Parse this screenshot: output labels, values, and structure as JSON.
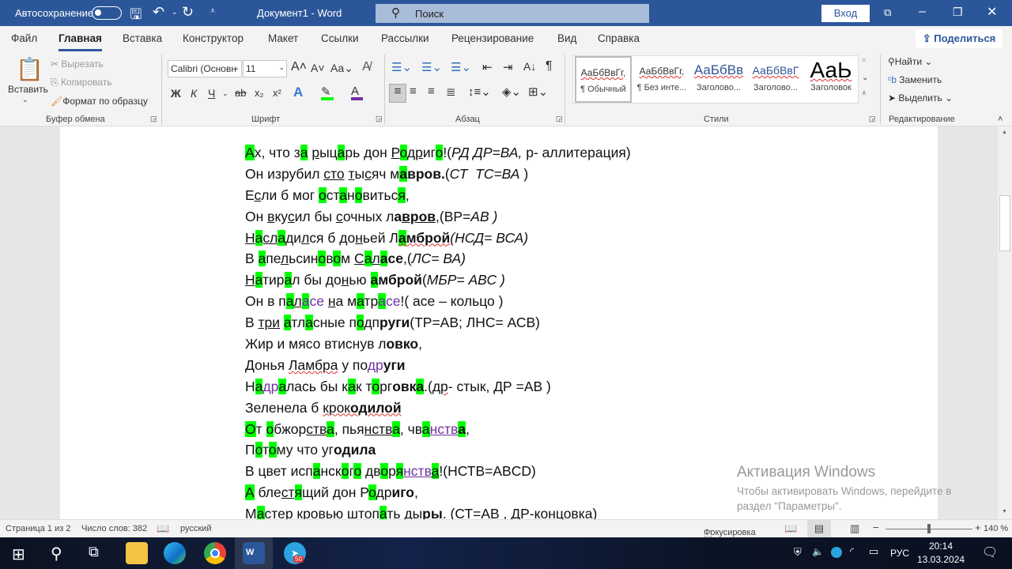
{
  "titlebar": {
    "autosave": "Автосохранение",
    "title": "Документ1  -  Word",
    "search": "Поиск",
    "login": "Вход"
  },
  "tabs": [
    "Файл",
    "Главная",
    "Вставка",
    "Конструктор",
    "Макет",
    "Ссылки",
    "Рассылки",
    "Рецензирование",
    "Вид",
    "Справка"
  ],
  "share": "Поделиться",
  "ribbon": {
    "clipboard": {
      "paste": "Вставить",
      "cut": "Вырезать",
      "copy": "Копировать",
      "format_painter": "Формат по образцу",
      "label": "Буфер обмена"
    },
    "font": {
      "name": "Calibri (Основн",
      "size": "11",
      "case": "Aa",
      "bold": "Ж",
      "italic": "К",
      "underline": "Ч",
      "strike": "ab",
      "sub": "x₂",
      "sup": "x²",
      "label": "Шрифт",
      "highlight_color": "#00ff00",
      "font_color": "#7030a0"
    },
    "paragraph": {
      "label": "Абзац"
    },
    "styles": {
      "items": [
        {
          "sample": "АаБбВвГг,",
          "name": "¶ Обычный"
        },
        {
          "sample": "АаБбВвГг,",
          "name": "¶ Без инте..."
        },
        {
          "sample": "АаБбВв",
          "name": "Заголово..."
        },
        {
          "sample": "АаБбВвГ",
          "name": "Заголово..."
        },
        {
          "sample": "АаЬ",
          "name": "Заголовок"
        }
      ],
      "label": "Стили"
    },
    "editing": {
      "find": "Найти",
      "replace": "Заменить",
      "select": "Выделить",
      "label": "Редактирование"
    }
  },
  "document": {
    "lines": [
      [
        {
          "t": "А",
          "f": "h"
        },
        {
          "t": "х, что з"
        },
        {
          "t": "а",
          "f": "h"
        },
        {
          "t": " "
        },
        {
          "t": "р",
          "f": "u"
        },
        {
          "t": "ыц"
        },
        {
          "t": "а",
          "f": "h"
        },
        {
          "t": "рь "
        },
        {
          "t": "д",
          "f": "u"
        },
        {
          "t": "он "
        },
        {
          "t": "Р",
          "f": "u"
        },
        {
          "t": "о",
          "f": "h"
        },
        {
          "t": "др",
          "f": "u"
        },
        {
          "t": "иг"
        },
        {
          "t": "о",
          "f": "h"
        },
        {
          "t": "!("
        },
        {
          "t": "РД ДР=ВА,",
          "f": "i"
        },
        {
          "t": " р- аллитерация)"
        }
      ],
      [
        {
          "t": "Он изрубил "
        },
        {
          "t": "сто",
          "f": "u"
        },
        {
          "t": " "
        },
        {
          "t": "т",
          "f": "u"
        },
        {
          "t": "ы"
        },
        {
          "t": "с",
          "f": "u"
        },
        {
          "t": "яч м"
        },
        {
          "t": "а",
          "f": "hb"
        },
        {
          "t": "вров.",
          "f": "b"
        },
        {
          "t": "("
        },
        {
          "t": "СТ  ТС=ВА",
          "f": "i"
        },
        {
          "t": " )"
        }
      ],
      [
        {
          "t": "Е"
        },
        {
          "t": "с",
          "f": "u"
        },
        {
          "t": "ли б мог "
        },
        {
          "t": "о",
          "f": "h"
        },
        {
          "t": "ст"
        },
        {
          "t": "а",
          "f": "h"
        },
        {
          "t": "н"
        },
        {
          "t": "о",
          "f": "h"
        },
        {
          "t": "вить"
        },
        {
          "t": "с"
        },
        {
          "t": "я",
          "f": "h"
        },
        {
          "t": ","
        }
      ],
      [
        {
          "t": "Он "
        },
        {
          "t": "в",
          "f": "u"
        },
        {
          "t": "ку"
        },
        {
          "t": "с",
          "f": "u"
        },
        {
          "t": "ил бы "
        },
        {
          "t": "с",
          "f": "u"
        },
        {
          "t": "очных л"
        },
        {
          "t": "а",
          "f": "b"
        },
        {
          "t": "вро",
          "f": "bu"
        },
        {
          "t": "в",
          "f": "bu"
        },
        {
          "t": ",(ВР="
        },
        {
          "t": "АВ )",
          "f": "i"
        }
      ],
      [
        {
          "t": "Н",
          "f": "u"
        },
        {
          "t": "а",
          "f": "h"
        },
        {
          "t": "сл",
          "f": "u"
        },
        {
          "t": "а",
          "f": "h"
        },
        {
          "t": "д",
          "f": "u"
        },
        {
          "t": "и"
        },
        {
          "t": "л",
          "f": "u"
        },
        {
          "t": "ся б "
        },
        {
          "t": "д",
          "f": "u"
        },
        {
          "t": "о"
        },
        {
          "t": "н",
          "f": "u"
        },
        {
          "t": "ьей Л"
        },
        {
          "t": "а",
          "f": "hbs"
        },
        {
          "t": "мброй",
          "f": "bs"
        },
        {
          "t": "(НСД= ВСА)",
          "f": "i"
        }
      ],
      [
        {
          "t": "В "
        },
        {
          "t": "а",
          "f": "h"
        },
        {
          "t": "пе"
        },
        {
          "t": "л",
          "f": "u"
        },
        {
          "t": "ьси"
        },
        {
          "t": "н"
        },
        {
          "t": "о",
          "f": "h"
        },
        {
          "t": "в"
        },
        {
          "t": "о",
          "f": "h"
        },
        {
          "t": "м "
        },
        {
          "t": "С",
          "f": "u"
        },
        {
          "t": "а",
          "f": "h"
        },
        {
          "t": "л",
          "f": "u"
        },
        {
          "t": "а",
          "f": "hb"
        },
        {
          "t": "се",
          "f": "b"
        },
        {
          "t": ",("
        },
        {
          "t": "ЛС= ВА)",
          "f": "i"
        }
      ],
      [
        {
          "t": "Н",
          "f": "u"
        },
        {
          "t": "а",
          "f": "h"
        },
        {
          "t": "тир"
        },
        {
          "t": "а",
          "f": "h"
        },
        {
          "t": "л бы до"
        },
        {
          "t": "н",
          "f": "u"
        },
        {
          "t": "ью "
        },
        {
          "t": "а",
          "f": "hb"
        },
        {
          "t": "мброй",
          "f": "b"
        },
        {
          "t": "("
        },
        {
          "t": "МБР= АВС )",
          "f": "i"
        }
      ],
      [
        {
          "t": "Он в п"
        },
        {
          "t": "а",
          "f": "h"
        },
        {
          "t": "л",
          "f": "u"
        },
        {
          "t": "а",
          "f": "hp"
        },
        {
          "t": "се",
          "f": "p"
        },
        {
          "t": " "
        },
        {
          "t": "н",
          "f": "u"
        },
        {
          "t": "а м"
        },
        {
          "t": "а",
          "f": "h"
        },
        {
          "t": "тр"
        },
        {
          "t": "а",
          "f": "hp"
        },
        {
          "t": "се",
          "f": "p"
        },
        {
          "t": "!( асе – кольцо )"
        }
      ],
      [
        {
          "t": "В "
        },
        {
          "t": "три",
          "f": "u"
        },
        {
          "t": " "
        },
        {
          "t": "а",
          "f": "h"
        },
        {
          "t": "тл"
        },
        {
          "t": "а",
          "f": "h"
        },
        {
          "t": "сные п"
        },
        {
          "t": "о",
          "f": "h"
        },
        {
          "t": "дп"
        },
        {
          "t": "руги",
          "f": "b"
        },
        {
          "t": "(ТР=АВ; ЛНС= АСВ)"
        }
      ],
      [
        {
          "t": "Жир и мясо втиснув л"
        },
        {
          "t": "овко",
          "f": "b"
        },
        {
          "t": ","
        }
      ],
      [
        {
          "t": "Донья "
        },
        {
          "t": "Ламбра",
          "f": "s"
        },
        {
          "t": " у по"
        },
        {
          "t": "др",
          "f": "p"
        },
        {
          "t": "уги",
          "f": "b"
        }
      ],
      [
        {
          "t": "Н"
        },
        {
          "t": "а",
          "f": "h"
        },
        {
          "t": "др",
          "f": "p"
        },
        {
          "t": "а",
          "f": "h"
        },
        {
          "t": "лась бы к"
        },
        {
          "t": "а",
          "f": "h"
        },
        {
          "t": "к т"
        },
        {
          "t": "о",
          "f": "h"
        },
        {
          "t": "рг"
        },
        {
          "t": "овк",
          "f": "b"
        },
        {
          "t": "а",
          "f": "hb"
        },
        {
          "t": ".("
        },
        {
          "t": "др",
          "f": "s"
        },
        {
          "t": "- стык, ДР =АВ )"
        }
      ],
      [
        {
          "t": "Зеленела б "
        },
        {
          "t": "крок",
          "f": "s"
        },
        {
          "t": "одилой",
          "f": "bs"
        }
      ],
      [
        {
          "t": "О",
          "f": "h"
        },
        {
          "t": "т "
        },
        {
          "t": "о",
          "f": "h"
        },
        {
          "t": "бжор"
        },
        {
          "t": "ств",
          "f": "u"
        },
        {
          "t": "а",
          "f": "h"
        },
        {
          "t": ", пья"
        },
        {
          "t": "нств",
          "f": "u"
        },
        {
          "t": "а",
          "f": "h"
        },
        {
          "t": ", чв"
        },
        {
          "t": "а",
          "f": "h"
        },
        {
          "t": "нств",
          "f": "pu"
        },
        {
          "t": "а",
          "f": "hb"
        },
        {
          "t": ","
        }
      ],
      [
        {
          "t": "П"
        },
        {
          "t": "о",
          "f": "h"
        },
        {
          "t": "т"
        },
        {
          "t": "о",
          "f": "h"
        },
        {
          "t": "му что уг"
        },
        {
          "t": "одила",
          "f": "b"
        }
      ],
      [
        {
          "t": "В цвет исп"
        },
        {
          "t": "а",
          "f": "h"
        },
        {
          "t": "нск"
        },
        {
          "t": "о",
          "f": "h"
        },
        {
          "t": "г"
        },
        {
          "t": "о",
          "f": "h"
        },
        {
          "t": " дв"
        },
        {
          "t": "о",
          "f": "h"
        },
        {
          "t": "р"
        },
        {
          "t": "я",
          "f": "h"
        },
        {
          "t": "нств",
          "f": "pu"
        },
        {
          "t": "а",
          "f": "hu"
        },
        {
          "t": "!(НСТВ=ABCD)"
        }
      ],
      [
        {
          "t": "А",
          "f": "h"
        },
        {
          "t": " бле"
        },
        {
          "t": "ст",
          "f": "u"
        },
        {
          "t": "я",
          "f": "h"
        },
        {
          "t": "щий дон Р"
        },
        {
          "t": "о",
          "f": "h"
        },
        {
          "t": "др"
        },
        {
          "t": "иго",
          "f": "b"
        },
        {
          "t": ","
        }
      ],
      [
        {
          "t": "М"
        },
        {
          "t": "а",
          "f": "h"
        },
        {
          "t": "стер кровью штоп"
        },
        {
          "t": "а",
          "f": "h"
        },
        {
          "t": "ть ды"
        },
        {
          "t": "ры",
          "f": "b"
        },
        {
          "t": ". (СТ=АВ , ДР-концовка)"
        }
      ]
    ]
  },
  "watermark": {
    "title": "Активация Windows",
    "line1": "Чтобы активировать Windows, перейдите в",
    "line2": "раздел \"Параметры\"."
  },
  "status": {
    "page": "Страница 1 из 2",
    "words": "Число слов: 382",
    "lang": "русский",
    "focus": "Фокусировка",
    "zoom": "140 %",
    "zoom_level_percent": 140
  },
  "taskbar": {
    "telegram_badge": "50",
    "lang": "РУС",
    "time": "20:14",
    "date": "13.03.2024"
  }
}
